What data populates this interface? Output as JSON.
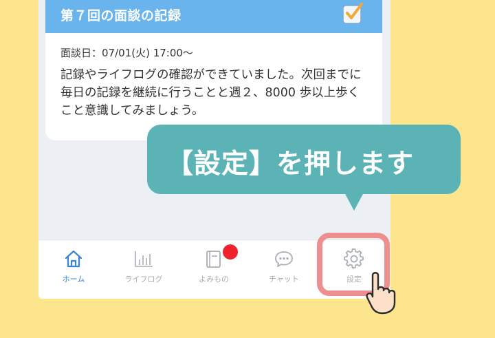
{
  "card": {
    "title": "第７回の面談の記録",
    "date": "面談日：07/01(火) 17:00～",
    "body": "記録やライフログの確認ができていました。次回までに毎日の記録を継続に行うことと週２、8000 歩以上歩くこと意識してみましょう。"
  },
  "tabbar": {
    "items": [
      {
        "label": "ホーム",
        "icon": "home-icon",
        "active": true
      },
      {
        "label": "ライフログ",
        "icon": "bar-chart-icon",
        "active": false
      },
      {
        "label": "よみもの",
        "icon": "book-icon",
        "active": false,
        "badge": true
      },
      {
        "label": "チャット",
        "icon": "chat-icon",
        "active": false
      },
      {
        "label": "設定",
        "icon": "gear-icon",
        "active": false
      }
    ]
  },
  "callout": {
    "text": "【設定】を押します"
  },
  "colors": {
    "background": "#FDE58E",
    "header": "#6AB4EE",
    "bubble": "#5BB3B5",
    "highlight": "#EE8F8F",
    "active_tab": "#3A82D8",
    "badge": "#F0222E"
  }
}
